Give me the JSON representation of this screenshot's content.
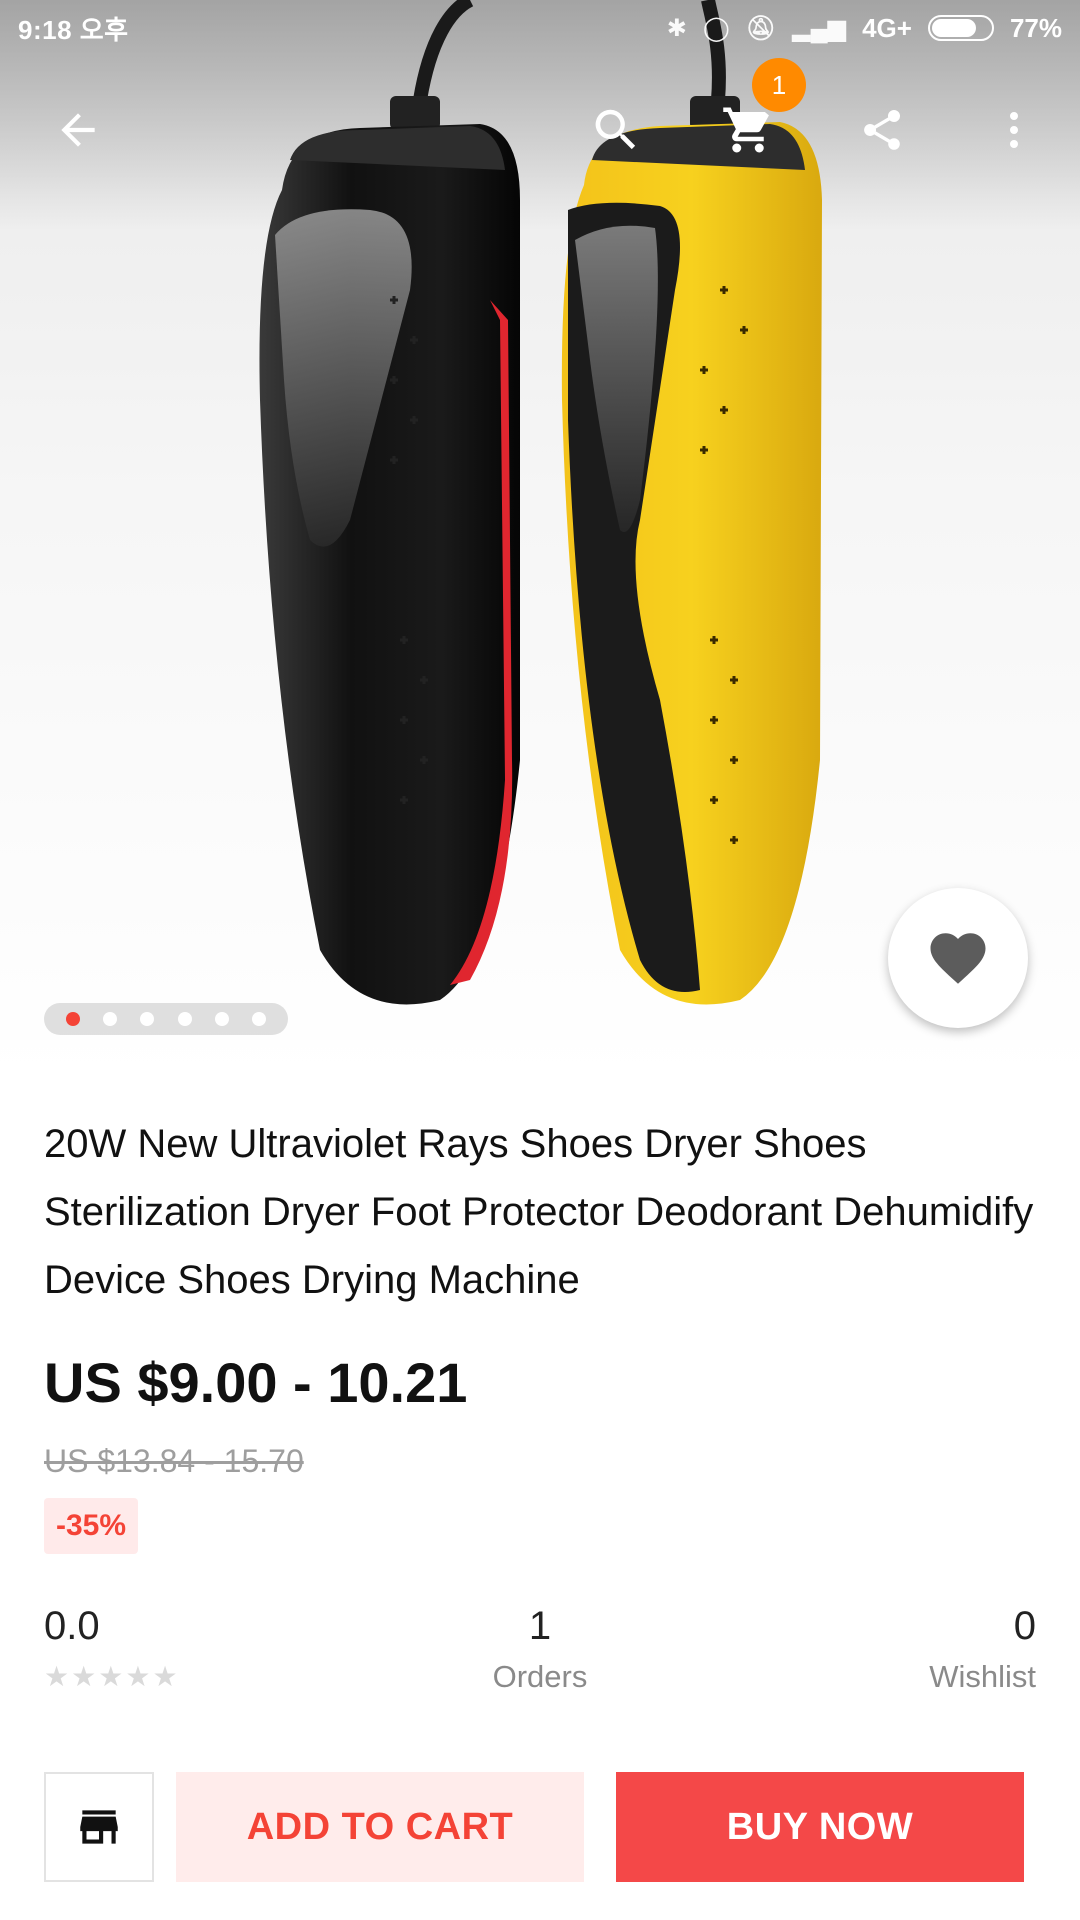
{
  "status_bar": {
    "time": "9:18 오후",
    "network": "4G+",
    "battery": "77%",
    "battery_level": 0.77
  },
  "action_bar": {
    "back_icon": "arrow-left-icon",
    "search_icon": "search-icon",
    "cart_icon": "cart-icon",
    "cart_count": "1",
    "share_icon": "share-icon",
    "more_icon": "more-vert-icon"
  },
  "carousel": {
    "total": 6,
    "active_index": 0
  },
  "product": {
    "title": "20W New Ultraviolet Rays Shoes Dryer Shoes Sterilization Dryer Foot Protector Deodorant Dehumidify Device Shoes Drying Machine",
    "price": "US $9.00 - 10.21",
    "original_price": "US $13.84 - 15.70",
    "discount": "-35%"
  },
  "stats": {
    "rating_value": "0.0",
    "rating_stars": 0,
    "orders_value": "1",
    "orders_label": "Orders",
    "wishlist_value": "0",
    "wishlist_label": "Wishlist"
  },
  "bottom_bar": {
    "store_icon": "store-icon",
    "add_to_cart_label": "ADD TO CART",
    "buy_now_label": "BUY NOW"
  },
  "colors": {
    "accent_red": "#f44848",
    "badge_orange": "#ff8a00",
    "cart_button_bg": "#ffeceb"
  }
}
